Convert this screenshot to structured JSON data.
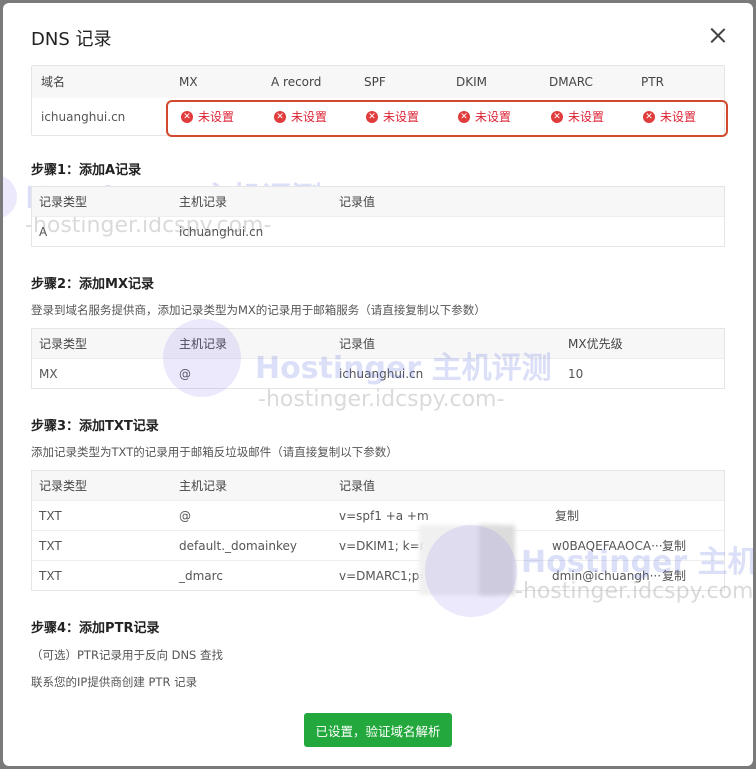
{
  "dialog": {
    "title": "DNS 记录"
  },
  "status": {
    "headers": [
      "域名",
      "MX",
      "A record",
      "SPF",
      "DKIM",
      "DMARC",
      "PTR"
    ],
    "domain": "ichuanghui.cn",
    "unset_label": "未设置"
  },
  "step1": {
    "title": "步骤1：添加A记录",
    "headers": [
      "记录类型",
      "主机记录",
      "记录值"
    ],
    "row": [
      "A",
      "ichuanghui.cn",
      ""
    ]
  },
  "step2": {
    "title": "步骤2：添加MX记录",
    "desc": "登录到域名服务提供商，添加记录类型为MX的记录用于邮箱服务（请直接复制以下参数）",
    "headers": [
      "记录类型",
      "主机记录",
      "记录值",
      "MX优先级"
    ],
    "row": [
      "MX",
      "@",
      "ichuanghui.cn",
      "10"
    ]
  },
  "step3": {
    "title": "步骤3：添加TXT记录",
    "desc": "添加记录类型为TXT的记录用于邮箱反垃圾邮件（请直接复制以下参数）",
    "headers": [
      "记录类型",
      "主机记录",
      "记录值"
    ],
    "rows": [
      {
        "type": "TXT",
        "host": "@",
        "value": "v=spf1 +a +m",
        "tail": "",
        "copy": "复制"
      },
      {
        "type": "TXT",
        "host": "default._domainkey",
        "value": "v=DKIM1; k=r",
        "tail": "w0BAQEFAAOCA···",
        "copy": "复制"
      },
      {
        "type": "TXT",
        "host": "_dmarc",
        "value": "v=DMARC1;p=",
        "tail": "dmin@ichuangh···",
        "copy": "复制"
      }
    ]
  },
  "step4": {
    "title": "步骤4：添加PTR记录",
    "line1": "（可选）PTR记录用于反向 DNS 查找",
    "line2": "联系您的IP提供商创建 PTR 记录"
  },
  "verify_button": "已设置，验证域名解析",
  "watermarks": {
    "brand": "Hostinger 主机评测",
    "url": "-hostinger.idcspy.com-"
  }
}
